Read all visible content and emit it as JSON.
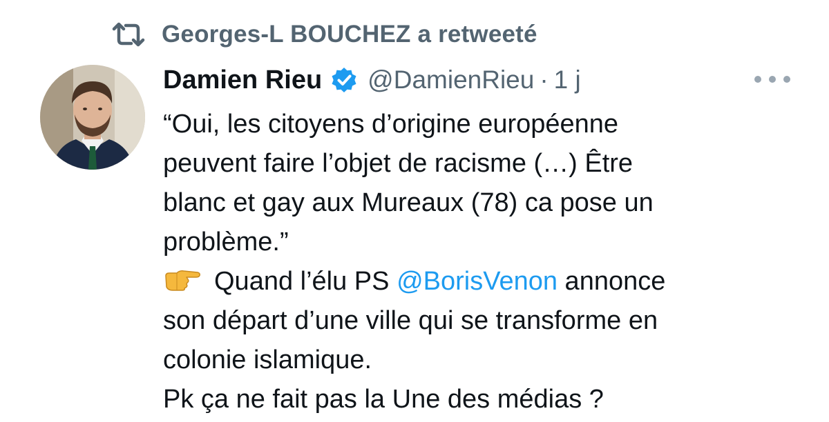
{
  "retweet": {
    "icon": "retweet-icon",
    "text": "Georges-L BOUCHEZ a retweeté"
  },
  "tweet": {
    "author": {
      "name": "Damien Rieu",
      "verified_icon": "verified-badge-icon",
      "handle": "@DamienRieu",
      "separator": "·",
      "time": "1 j"
    },
    "more_icon": "more-options-icon",
    "body_lines": [
      "“Oui, les citoyens d’origine européenne",
      "peuvent faire l’objet de racisme (…) Être",
      "blanc et gay aux Mureaux (78) ca pose un",
      "problème.”"
    ],
    "mention_line": {
      "emoji_icon": "pointing-right-hand-icon",
      "before": "Quand l’élu PS ",
      "mention": "@BorisVenon",
      "after": " annonce"
    },
    "body_lines_2": [
      "son départ d’une ville qui se transforme en",
      "colonie islamique.",
      "Pk ça ne fait pas la Une des médias ?"
    ]
  },
  "colors": {
    "text": "#0f1419",
    "secondary": "#536471",
    "link": "#1d9bf0",
    "verified": "#1d9bf0"
  }
}
